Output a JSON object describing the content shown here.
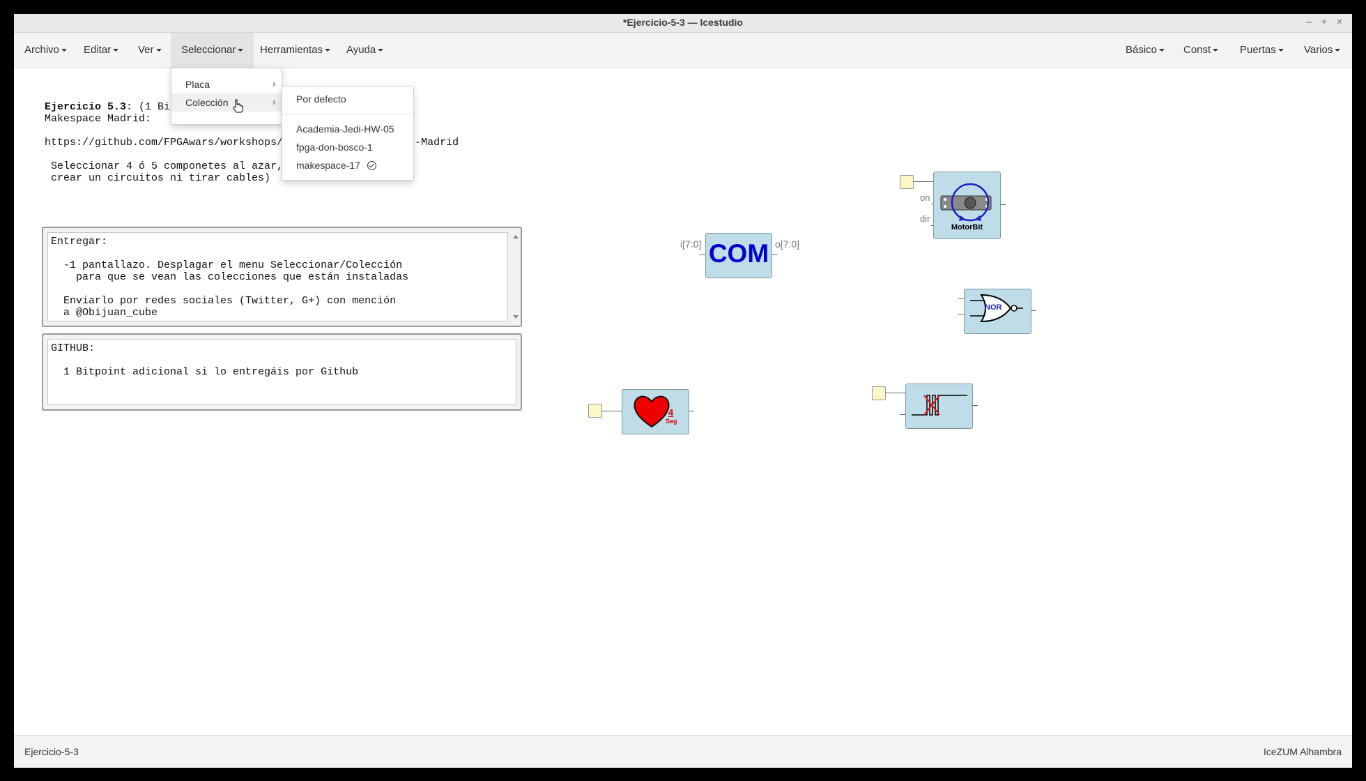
{
  "window": {
    "title": "*Ejercicio-5-3 — Icestudio",
    "controls": [
      "–",
      "+",
      "×"
    ]
  },
  "menubar": {
    "left": [
      "Archivo",
      "Editar",
      "Ver",
      "Seleccionar",
      "Herramientas",
      "Ayuda"
    ],
    "right": [
      "Básico",
      "Const",
      "Puertas",
      "Varios"
    ]
  },
  "select_menu": {
    "items": [
      "Placa",
      "Colección"
    ],
    "collections": {
      "default": "Por defecto",
      "items": [
        "Academia-Jedi-HW-05",
        "fpga-don-bosco-1",
        "makespace-17"
      ],
      "selected": "makespace-17"
    }
  },
  "info_text": {
    "title_bold": "Ejercicio 5.3",
    "title_rest": ": (1 Bitpoint). Practicando en el Taller del",
    "line2": "Makespace Madrid:",
    "url": "https://github.com/FPGAwars/workshops/tree/master/Makespace-Madrid",
    "line4": " Seleccionar 4 ó 5 componetes al azar, no hace falta",
    "line5": " crear un circuitos ni tirar cables)"
  },
  "memo_entregar": {
    "text": "Entregar:\n\n  -1 pantallazo. Desplagar el menu Seleccionar/Colección\n    para que se vean las colecciones que están instaladas\n\n  Enviarlo por redes sociales (Twitter, G+) con mención\n  a @Obijuan_cube"
  },
  "memo_github": {
    "text": "GITHUB:\n\n  1 Bitpoint adicional si lo entregáis por Github"
  },
  "blocks": {
    "com": {
      "label": "COM",
      "in_port": "i[7:0]",
      "out_port": "o[7:0]"
    },
    "motorbit": {
      "label": "MotorBit",
      "in_on": "on",
      "in_dir": "dir"
    },
    "nor": {
      "label": "NOR"
    },
    "heart": {
      "value": "4",
      "unit": "Seg"
    }
  },
  "status": {
    "left": "Ejercicio-5-3",
    "right": "IceZUM Alhambra"
  },
  "colors": {
    "block_fill": "#bfdde8",
    "memo_border": "#9a9a9a",
    "io_fill": "#fbf7c7",
    "com_text": "#0000d0",
    "heart": "#ee0000"
  }
}
